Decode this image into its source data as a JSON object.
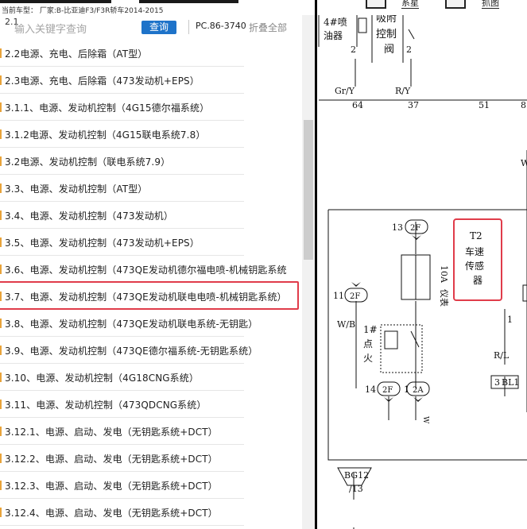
{
  "topbar": {
    "car_model": "当前车型： 厂家:B-比亚迪F3/F3R轿车2014-2015",
    "btn1_label": "系星",
    "btn2_label": "抓图"
  },
  "search": {
    "first_item": "2.1",
    "placeholder": "输入关键字查询",
    "button": "查询",
    "page_code": "PC.86-3740",
    "collapse_label": "折叠全部"
  },
  "tree": {
    "items": [
      "2.2电源、充电、后除霜（AT型）",
      "2.3电源、充电、后除霜（473发动机+EPS）",
      "3.1.1、电源、发动机控制（4G15德尔福系统）",
      "3.1.2电源、发动机控制（4G15联电系统7.8）",
      "3.2电源、发动机控制（联电系统7.9）",
      "3.3、电源、发动机控制（AT型）",
      "3.4、电源、发动机控制（473发动机）",
      "3.5、电源、发动机控制（473发动机+EPS）",
      "3.6、电源、发动机控制（473QE发动机德尔福电喷-机械钥匙系统",
      "3.7、电源、发动机控制（473QE发动机联电电喷-机械钥匙系统）",
      "3.8、电源、发动机控制（473QE发动机联电系统-无钥匙）",
      "3.9、电源、发动机控制（473QE德尔福系统-无钥匙系统）",
      "3.10、电源、发动机控制（4G18CNG系统）",
      "3.11、电源、发动机控制（473QDCNG系统）",
      "3.12.1、电源、启动、发电（无钥匙系统+DCT）",
      "3.12.2、电源、启动、发电（无钥匙系统+DCT）",
      "3.12.3、电源、启动、发电（无钥匙系统+DCT）",
      "3.12.4、电源、启动、发电（无钥匙系统+DCT）"
    ],
    "selected_index": 9
  },
  "diagram": {
    "injector_label_1": "4#喷",
    "injector_label_2": "油器",
    "injector_pin": "2",
    "absorb_1": "吸附",
    "absorb_2": "控制",
    "absorb_3": "阀",
    "absorb_pin": "2",
    "wire_gy": "Gr/Y",
    "wire_ry": "R/Y",
    "pin_64": "64",
    "pin_37": "37",
    "pin_51": "51",
    "pin_8": "8",
    "edge_w": "W",
    "conn_13": "13",
    "conn_2f_a": "2F",
    "fuse_label_1": "10A",
    "fuse_label_2": "仪表",
    "sensor_t2": "T2",
    "sensor_1": "车速",
    "sensor_2": "传感",
    "sensor_3": "器",
    "pin_1": "1",
    "conn_11": "11",
    "conn_2f_b": "2F",
    "wire_wb": "W/B",
    "relay_1": "1#",
    "relay_2": "点",
    "relay_3": "火",
    "wire_rl": "R/L",
    "conn_3": "3",
    "conn_bl1": "BL1",
    "conn_14": "14",
    "conn_2f_c": "2F",
    "conn_1": "1",
    "conn_2a": "2A",
    "wire_w": "W",
    "ground_1": "BG12",
    "ground_2": "/13"
  },
  "colors": {
    "highlight": "#e03c4a",
    "search_button": "#1e73c9",
    "tree_marker": "#e8a33a"
  }
}
